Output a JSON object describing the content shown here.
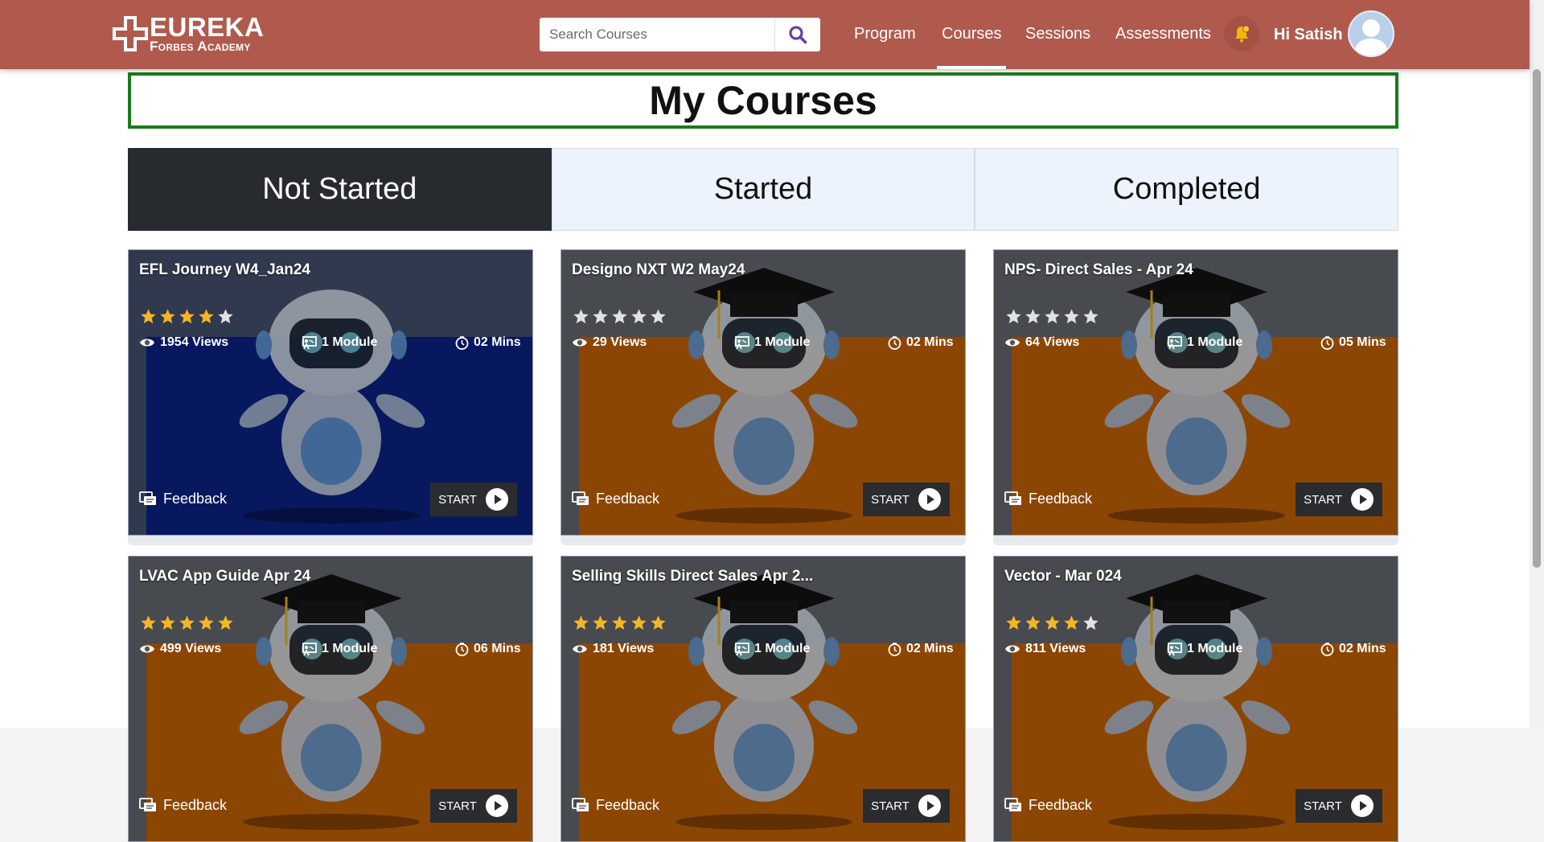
{
  "header": {
    "logo_text_1": "EUREKA",
    "logo_text_2": "Forbes Academy",
    "search_placeholder": "Search Courses",
    "nav": [
      "Program",
      "Courses",
      "Sessions",
      "Assessments"
    ],
    "active_nav": "Courses",
    "greeting": "Hi Satish",
    "icons": {
      "search": "search-icon",
      "bell": "bell-icon",
      "avatar": "user-avatar-icon"
    },
    "colors": {
      "header_bg": "#b05a4e",
      "search_icon": "#6a3fa0",
      "bell": "#f5b80a"
    }
  },
  "main": {
    "title": "My Courses",
    "tabs": [
      "Not Started",
      "Started",
      "Completed"
    ],
    "active_tab": "Not Started"
  },
  "courses": [
    {
      "title": "EFL Journey W4_Jan24",
      "rating": 4,
      "views": "1954 Views",
      "modules": "1 Module",
      "duration": "02 Mins",
      "feedback": "Feedback",
      "start": "START",
      "theme": "blue"
    },
    {
      "title": "Designo NXT W2 May24",
      "rating": 0,
      "views": "29 Views",
      "modules": "1 Module",
      "duration": "02 Mins",
      "feedback": "Feedback",
      "start": "START",
      "theme": "orange"
    },
    {
      "title": "NPS- Direct Sales - Apr 24",
      "rating": 0,
      "views": "64 Views",
      "modules": "1 Module",
      "duration": "05 Mins",
      "feedback": "Feedback",
      "start": "START",
      "theme": "orange"
    },
    {
      "title": "LVAC App Guide Apr 24",
      "rating": 5,
      "views": "499 Views",
      "modules": "1 Module",
      "duration": "06 Mins",
      "feedback": "Feedback",
      "start": "START",
      "theme": "orange"
    },
    {
      "title": "Selling Skills Direct Sales Apr 2...",
      "rating": 5,
      "views": "181 Views",
      "modules": "1 Module",
      "duration": "02 Mins",
      "feedback": "Feedback",
      "start": "START",
      "theme": "orange"
    },
    {
      "title": "Vector - Mar 024",
      "rating": 4,
      "views": "811 Views",
      "modules": "1 Module",
      "duration": "02 Mins",
      "feedback": "Feedback",
      "start": "START",
      "theme": "orange"
    }
  ],
  "colors": {
    "star_filled": "#f5b524",
    "star_empty": "#e2e2e2",
    "tab_active_bg": "#272a2f",
    "tab_bg": "#edf3fc",
    "title_border": "#1b7a1b"
  }
}
